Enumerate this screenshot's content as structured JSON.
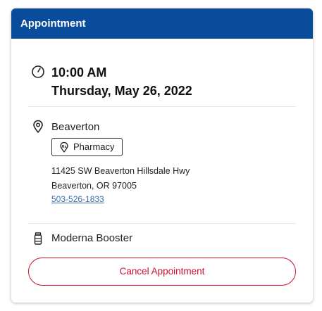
{
  "header": {
    "title": "Appointment",
    "color": "#0a4c9c"
  },
  "appointment": {
    "time": "10:00 AM",
    "date": "Thursday, May 26, 2022",
    "time_icon": "clock-icon"
  },
  "location": {
    "name": "Beaverton",
    "icon": "location-pin-icon",
    "badge": {
      "label": "Pharmacy",
      "icon": "rx-pharmacy-icon"
    },
    "address_line1": "11425 SW Beaverton Hillsdale Hwy",
    "address_line2": "Beaverton, OR 97005",
    "phone": "503-526-1833"
  },
  "vaccine": {
    "name": "Moderna Booster",
    "icon": "vaccine-vial-icon"
  },
  "actions": {
    "cancel_label": "Cancel Appointment",
    "cancel_color": "#c8102e"
  }
}
